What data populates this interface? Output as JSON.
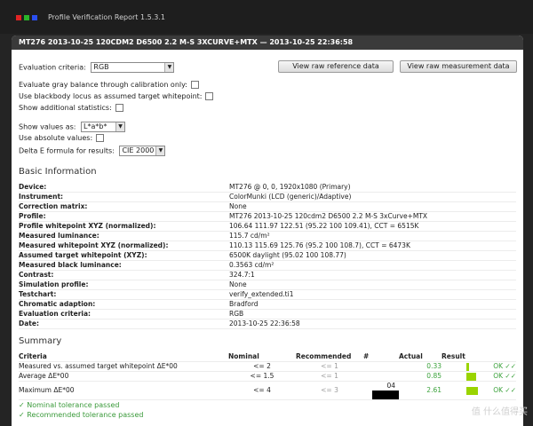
{
  "app": {
    "title": "Profile Verification Report 1.5.3.1",
    "colors": {
      "red": "#e02424",
      "green": "#2ab52a",
      "blue": "#2a4ff0"
    }
  },
  "panel": {
    "title": "MT276 2013-10-25 120CDM2 D6500 2.2 M-S 3XCURVE+MTX — 2013-10-25 22:36:58"
  },
  "controls": {
    "evaluation_label": "Evaluation criteria:",
    "evaluation_value": "RGB",
    "raw_reference_button": "View raw reference data",
    "raw_measurement_button": "View raw measurement data",
    "gray_balance_label": "Evaluate gray balance through calibration only:",
    "blackbody_label": "Use blackbody locus as assumed target whitepoint:",
    "additional_stats_label": "Show additional statistics:",
    "show_values_label": "Show values as:",
    "show_values_value": "L*a*b*",
    "absolute_values_label": "Use absolute values:",
    "delta_e_label": "Delta E formula for results:",
    "delta_e_value": "CIE 2000"
  },
  "basic_info": {
    "heading": "Basic Information",
    "rows": [
      {
        "key": "Device:",
        "value": "MT276 @ 0, 0, 1920x1080 (Primary)"
      },
      {
        "key": "Instrument:",
        "value": "ColorMunki (LCD (generic)/Adaptive)"
      },
      {
        "key": "Correction matrix:",
        "value": "None"
      },
      {
        "key": "Profile:",
        "value": "MT276 2013-10-25 120cdm2 D6500 2.2 M-S 3xCurve+MTX"
      },
      {
        "key": "Profile whitepoint XYZ (normalized):",
        "value": "106.64 111.97 122.51 (95.22 100 109.41), CCT = 6515K"
      },
      {
        "key": "Measured luminance:",
        "value": "115.7 cd/m²"
      },
      {
        "key": "Measured whitepoint XYZ (normalized):",
        "value": "110.13 115.69 125.76 (95.2 100 108.7), CCT = 6473K"
      },
      {
        "key": "Assumed target whitepoint (XYZ):",
        "value": "6500K daylight (95.02 100 108.77)"
      },
      {
        "key": "Measured black luminance:",
        "value": "0.3563 cd/m²"
      },
      {
        "key": "Contrast:",
        "value": "324.7:1"
      },
      {
        "key": "Simulation profile:",
        "value": "None"
      },
      {
        "key": "Testchart:",
        "value": "verify_extended.ti1"
      },
      {
        "key": "Chromatic adaption:",
        "value": "Bradford"
      },
      {
        "key": "Evaluation criteria:",
        "value": "RGB"
      },
      {
        "key": "Date:",
        "value": "2013-10-25 22:36:58"
      }
    ]
  },
  "summary": {
    "heading": "Summary",
    "headers": {
      "criteria": "Criteria",
      "nominal": "Nominal",
      "recommended": "Recommended",
      "num": "#",
      "actual": "Actual",
      "result": "Result"
    },
    "rows": [
      {
        "criteria": "Measured vs. assumed target whitepoint ΔE*00",
        "nominal": "<= 2",
        "recommended": "<= 1",
        "num": "",
        "actual": "0.33",
        "result": "OK ✓✓",
        "bar_fraction": 0.17
      },
      {
        "criteria": "Average ΔE*00",
        "nominal": "<= 1.5",
        "recommended": "<= 1",
        "num": "",
        "actual": "0.85",
        "result": "OK ✓✓",
        "bar_fraction": 0.57
      },
      {
        "criteria": "Maximum ΔE*00",
        "nominal": "<= 4",
        "recommended": "<= 3",
        "num": "04",
        "actual": "2.61",
        "result": "OK ✓✓",
        "bar_fraction": 0.65
      }
    ],
    "passed": [
      "✓ Nominal tolerance passed",
      "✓ Recommended tolerance passed"
    ]
  },
  "watermark": "值 什么值得买"
}
